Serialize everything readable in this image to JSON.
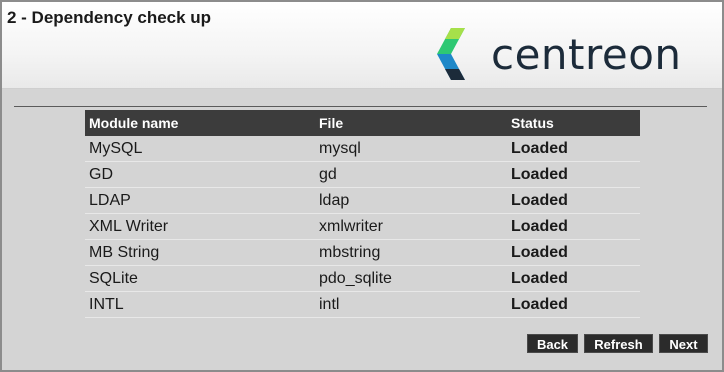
{
  "header": {
    "step_title": "2 - Dependency check up",
    "logo_text": "centreon",
    "logo_colors": {
      "green": "#2ec873",
      "blue": "#1e88c8",
      "navy": "#1c2b3a"
    }
  },
  "table": {
    "columns": [
      "Module name",
      "File",
      "Status"
    ],
    "rows": [
      {
        "module": "MySQL",
        "file": "mysql",
        "status": "Loaded"
      },
      {
        "module": "GD",
        "file": "gd",
        "status": "Loaded"
      },
      {
        "module": "LDAP",
        "file": "ldap",
        "status": "Loaded"
      },
      {
        "module": "XML Writer",
        "file": "xmlwriter",
        "status": "Loaded"
      },
      {
        "module": "MB String",
        "file": "mbstring",
        "status": "Loaded"
      },
      {
        "module": "SQLite",
        "file": "pdo_sqlite",
        "status": "Loaded"
      },
      {
        "module": "INTL",
        "file": "intl",
        "status": "Loaded"
      }
    ],
    "status_color": "#1fcc1f"
  },
  "buttons": {
    "back": "Back",
    "refresh": "Refresh",
    "next": "Next"
  }
}
